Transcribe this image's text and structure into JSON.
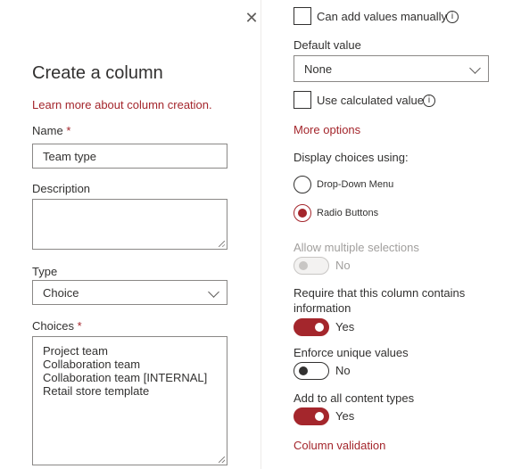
{
  "panel": {
    "title": "Create a column",
    "learn_more": "Learn more about column creation.",
    "close_symbol": "✕"
  },
  "name": {
    "label": "Name",
    "required_mark": "*",
    "value": "Team type"
  },
  "description": {
    "label": "Description",
    "value": ""
  },
  "type": {
    "label": "Type",
    "value": "Choice"
  },
  "choices": {
    "label": "Choices",
    "required_mark": "*",
    "value": "Project team\nCollaboration team\nCollaboration team [INTERNAL]\nRetail store template"
  },
  "manual_values": {
    "label": "Can add values manually",
    "checked": false,
    "info_icon": "i"
  },
  "default_value": {
    "label": "Default value",
    "value": "None"
  },
  "calculated": {
    "label": "Use calculated value",
    "checked": false,
    "info_icon": "i"
  },
  "more_options": "More options",
  "display": {
    "label": "Display choices using:",
    "options": [
      {
        "label": "Drop-Down Menu",
        "selected": false
      },
      {
        "label": "Radio Buttons",
        "selected": true
      }
    ]
  },
  "multiple": {
    "label": "Allow multiple selections",
    "state": "No",
    "enabled": false
  },
  "require": {
    "label": "Require that this column contains information",
    "state": "Yes"
  },
  "unique": {
    "label": "Enforce unique values",
    "state": "No"
  },
  "content_types": {
    "label": "Add to all content types",
    "state": "Yes"
  },
  "column_validation": "Column validation",
  "colors": {
    "accent": "#a4262c",
    "text": "#323130",
    "border": "#8a8886",
    "disabled": "#a19f9d"
  }
}
